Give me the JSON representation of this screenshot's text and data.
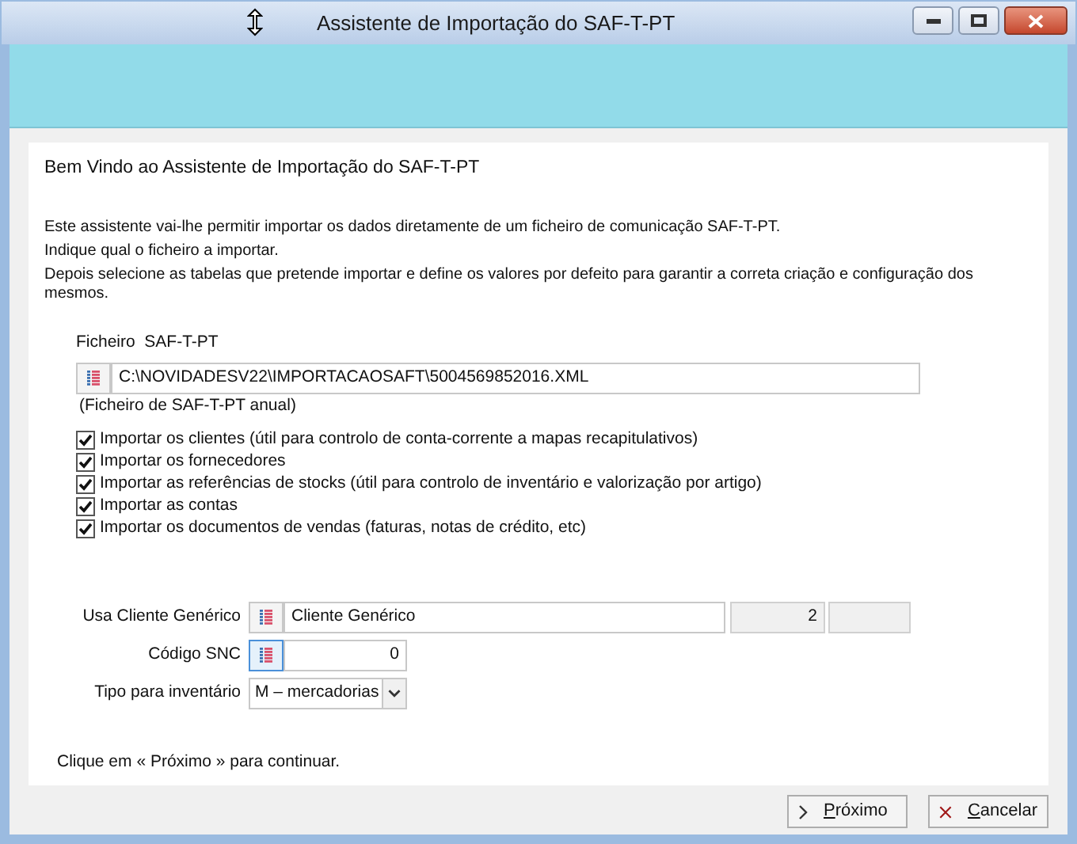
{
  "window": {
    "title": "Assistente de Importação do SAF-T-PT"
  },
  "heading": "Bem Vindo ao Assistente de Importação do SAF-T-PT",
  "intro": [
    "Este assistente vai-lhe permitir importar os dados diretamente de um ficheiro de comunicação SAF-T-PT.",
    "Indique qual o ficheiro a importar.",
    "Depois selecione as tabelas que pretende importar e define os valores por defeito para garantir a correta criação e configuração dos mesmos."
  ],
  "file": {
    "label": "Ficheiro  SAF-T-PT",
    "value": "C:\\NOVIDADESV22\\IMPORTACAOSAFT\\5004569852016.XML",
    "hint": "(Ficheiro de SAF-T-PT anual)"
  },
  "options": [
    {
      "label": "Importar os clientes (útil para controlo de conta-corrente a mapas recapitulativos)",
      "checked": true
    },
    {
      "label": "Importar os fornecedores",
      "checked": true
    },
    {
      "label": "Importar as referências de stocks (útil para controlo de inventário e valorização por artigo)",
      "checked": true
    },
    {
      "label": "Importar as contas",
      "checked": true
    },
    {
      "label": "Importar os documentos de vendas (faturas, notas de crédito, etc)",
      "checked": true
    }
  ],
  "generic_client": {
    "label": "Usa Cliente Genérico",
    "value": "Cliente Genérico",
    "number": "2"
  },
  "snc_code": {
    "label": "Código SNC",
    "value": "0"
  },
  "inventory_type": {
    "label": "Tipo para inventário",
    "value": "M – mercadorias"
  },
  "footer_note": "Clique em « Próximo » para continuar.",
  "buttons": [
    {
      "label": "Próximo",
      "kind": "next"
    },
    {
      "label": "Cancelar",
      "kind": "cancel"
    }
  ]
}
